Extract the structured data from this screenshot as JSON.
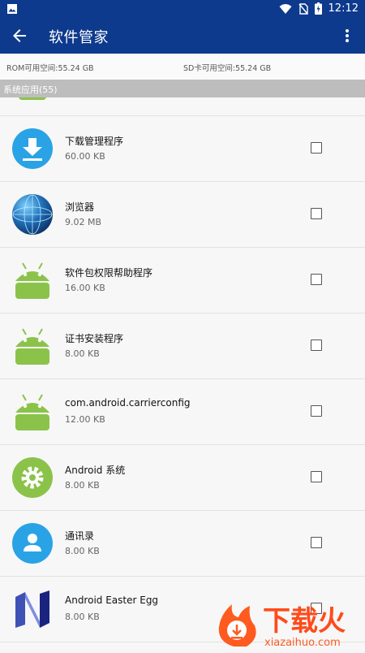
{
  "status_bar": {
    "time": "12:12",
    "icons": [
      "image-icon",
      "wifi-icon",
      "no-sim-icon",
      "battery-charging-icon"
    ]
  },
  "app_bar": {
    "title": "软件管家",
    "back_icon": "arrow-back-icon",
    "menu_icon": "more-vert-icon"
  },
  "storage": {
    "rom": "ROM可用空间:55.24 GB",
    "sd": "SD卡可用空间:55.24 GB"
  },
  "section": {
    "title": "系统应用(55)"
  },
  "apps": [
    {
      "name": "下载管理程序",
      "size": "60.00 KB",
      "icon": "download-icon"
    },
    {
      "name": "浏览器",
      "size": "9.02 MB",
      "icon": "globe-icon"
    },
    {
      "name": "软件包权限帮助程序",
      "size": "16.00 KB",
      "icon": "android-icon"
    },
    {
      "name": "证书安装程序",
      "size": "8.00 KB",
      "icon": "android-icon"
    },
    {
      "name": "com.android.carrierconfig",
      "size": "12.00 KB",
      "icon": "android-icon"
    },
    {
      "name": "Android 系统",
      "size": "8.00 KB",
      "icon": "settings-gear-icon"
    },
    {
      "name": "通讯录",
      "size": "8.00 KB",
      "icon": "contacts-icon"
    },
    {
      "name": "Android Easter Egg",
      "size": "8.00 KB",
      "icon": "nougat-icon"
    }
  ],
  "watermark": {
    "text": "下载火",
    "url": "xiazaihuo.com"
  },
  "colors": {
    "app_bar": "#0d3a8c",
    "section_bg": "#bdbdbd",
    "android_green": "#8bc34a",
    "download_blue": "#29a3e6"
  }
}
